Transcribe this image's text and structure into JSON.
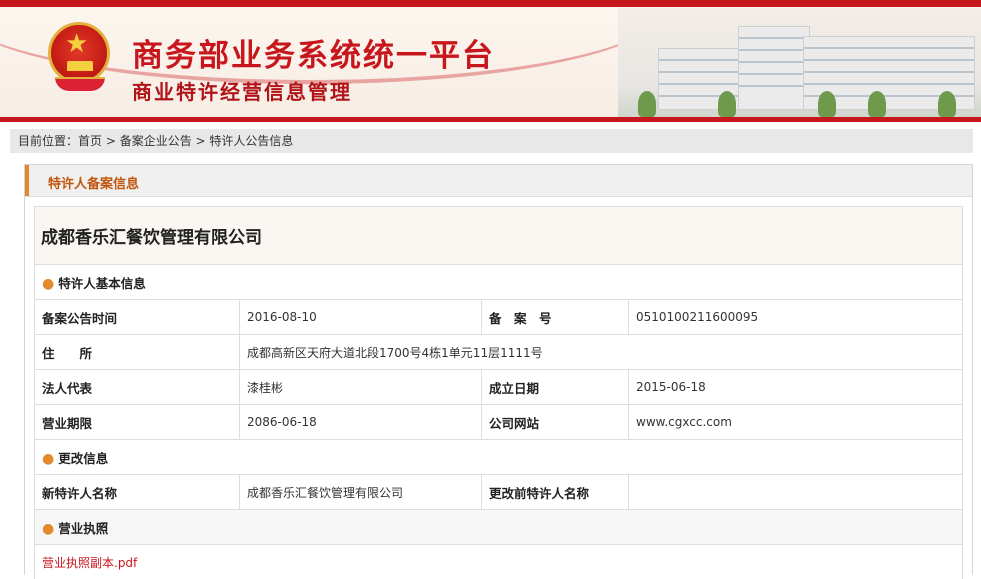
{
  "header": {
    "title": "商务部业务系统统一平台",
    "subtitle": "商业特许经营信息管理"
  },
  "breadcrumb": {
    "prefix": "目前位置：",
    "items": [
      "首页",
      "备案企业公告",
      "特许人公告信息"
    ],
    "separator": " > "
  },
  "panel": {
    "title": "特许人备案信息"
  },
  "company": {
    "name": "成都香乐汇餐饮管理有限公司"
  },
  "basic": {
    "section_title": "特许人基本信息",
    "announce_date_label": "备案公告时间",
    "announce_date": "2016-08-10",
    "record_no_label": "备　案　号",
    "record_no": "0510100211600095",
    "address_label": "住　　所",
    "address": "成都高新区天府大道北段1700号4栋1单元11层1111号",
    "legal_rep_label": "法人代表",
    "legal_rep": "漆桂彬",
    "founded_label": "成立日期",
    "founded": "2015-06-18",
    "term_label": "营业期限",
    "term": "2086-06-18",
    "website_label": "公司网站",
    "website": "www.cgxcc.com"
  },
  "change": {
    "section_title": "更改信息",
    "new_name_label": "新特许人名称",
    "new_name": "成都香乐汇餐饮管理有限公司",
    "old_name_label": "更改前特许人名称",
    "old_name": ""
  },
  "license": {
    "section_title": "营业执照",
    "file_link": "营业执照副本.pdf"
  },
  "colors": {
    "brand_red": "#c8161d",
    "accent_orange": "#e38a2f"
  }
}
